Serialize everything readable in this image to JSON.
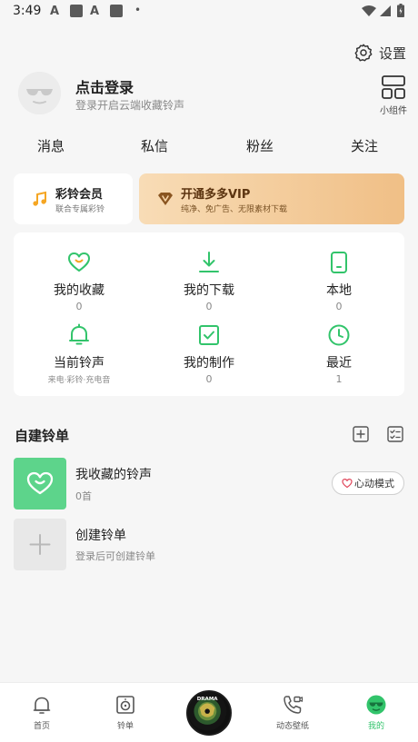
{
  "status_bar": {
    "time": "3:49",
    "notif_a_glyph": "A"
  },
  "header": {
    "settings_label": "设置",
    "login_title": "点击登录",
    "login_subtitle": "登录开启云端收藏铃声",
    "widget_label": "小组件"
  },
  "social": [
    "消息",
    "私信",
    "粉丝",
    "关注"
  ],
  "vip": {
    "member_title": "彩铃会员",
    "member_sub": "联合专属彩铃",
    "vip_title": "开通多多VIP",
    "vip_sub": "纯净、免广告、无限素材下载"
  },
  "quick_grid": [
    {
      "label": "我的收藏",
      "sub": "0",
      "icon": "heart-icon"
    },
    {
      "label": "我的下载",
      "sub": "0",
      "icon": "download-icon"
    },
    {
      "label": "本地",
      "sub": "0",
      "icon": "phone-icon"
    },
    {
      "label": "当前铃声",
      "sub": "来电·彩铃·充电音",
      "icon": "bell-icon"
    },
    {
      "label": "我的制作",
      "sub": "0",
      "icon": "checkbox-icon"
    },
    {
      "label": "最近",
      "sub": "1",
      "icon": "clock-icon"
    }
  ],
  "playlists": {
    "title": "自建铃单",
    "items": [
      {
        "name": "我收藏的铃声",
        "sub": "0首"
      },
      {
        "name": "创建铃单",
        "sub": "登录后可创建铃单"
      }
    ],
    "mode_button": "心动模式"
  },
  "tabbar": {
    "items": [
      {
        "label": "首页",
        "icon": "bell-tab-icon"
      },
      {
        "label": "铃单",
        "icon": "speaker-icon"
      },
      {
        "label": "动态壁纸",
        "icon": "phone-video-icon"
      },
      {
        "label": "我的",
        "icon": "profile-icon"
      }
    ],
    "disc_text": "DRAMA"
  },
  "colors": {
    "accent": "#32c46b",
    "accent_light": "#5dd48b",
    "vip_gold": "#f0bf86"
  }
}
